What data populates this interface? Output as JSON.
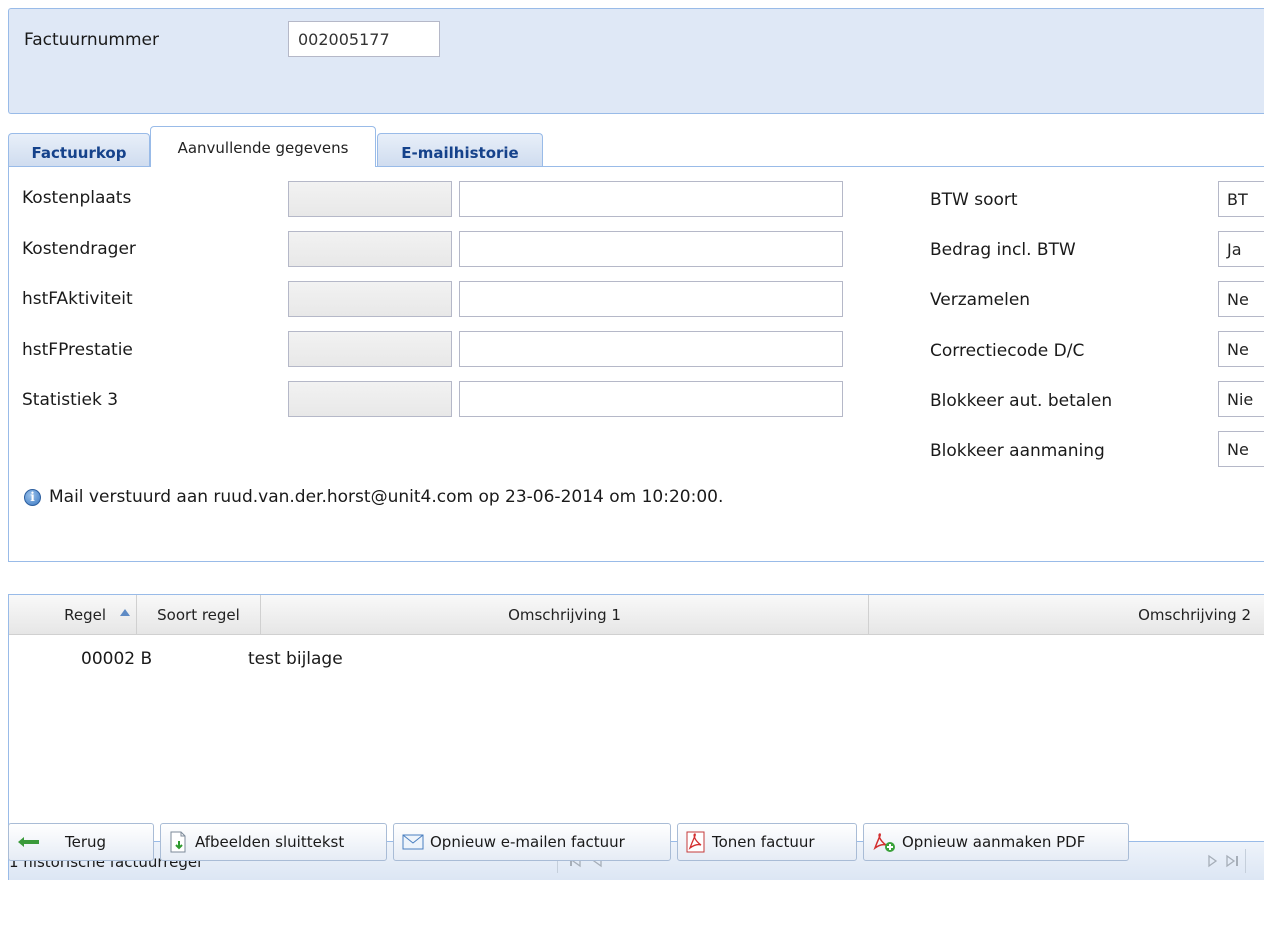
{
  "header": {
    "invoice_label": "Factuurnummer",
    "invoice_number": "002005177"
  },
  "tabs": [
    {
      "label": "Factuurkop",
      "active": false
    },
    {
      "label": "Aanvullende gegevens",
      "active": true
    },
    {
      "label": "E-mailhistorie",
      "active": false
    }
  ],
  "form": {
    "left_fields": [
      {
        "label": "Kostenplaats",
        "code": "",
        "description": ""
      },
      {
        "label": "Kostendrager",
        "code": "",
        "description": ""
      },
      {
        "label": "hstFAktiviteit",
        "code": "",
        "description": ""
      },
      {
        "label": "hstFPrestatie",
        "code": "",
        "description": ""
      },
      {
        "label": "Statistiek 3",
        "code": "",
        "description": ""
      }
    ],
    "right_fields": [
      {
        "label": "BTW soort",
        "value": "BT"
      },
      {
        "label": "Bedrag incl. BTW",
        "value": "Ja"
      },
      {
        "label": "Verzamelen",
        "value": "Ne"
      },
      {
        "label": "Correctiecode D/C",
        "value": "Ne"
      },
      {
        "label": "Blokkeer aut. betalen",
        "value": "Nie"
      },
      {
        "label": "Blokkeer aanmaning",
        "value": "Ne"
      }
    ],
    "info_message": "Mail verstuurd aan ruud.van.der.horst@unit4.com op 23-06-2014 om 10:20:00."
  },
  "grid": {
    "columns": [
      "Regel",
      "Soort regel",
      "Omschrijving 1",
      "Omschrijving 2"
    ],
    "rows": [
      {
        "regel": "00002 B",
        "soort": "",
        "omschrijving1": "test bijlage",
        "omschrijving2": ""
      }
    ],
    "pager_text": "1 historische factuurregel"
  },
  "buttons": {
    "back": "Terug",
    "closing_text": "Afbeelden sluittekst",
    "resend_email": "Opnieuw e-mailen factuur",
    "show_invoice": "Tonen factuur",
    "recreate_pdf": "Opnieuw aanmaken PDF"
  },
  "colors": {
    "panel_bg": "#dfe8f6",
    "border": "#99bbe8",
    "tab_text": "#15428b"
  }
}
